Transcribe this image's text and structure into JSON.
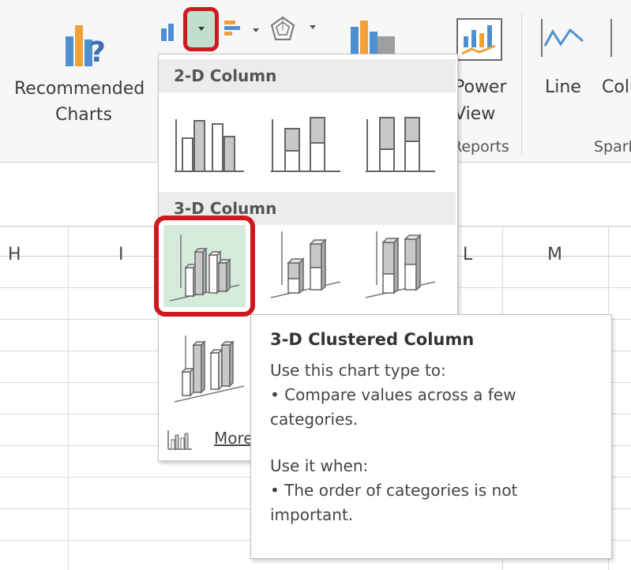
{
  "ribbon": {
    "recommended_line1": "Recommended",
    "recommended_line2": "Charts",
    "power_line1": "Power",
    "power_line2": "View",
    "reports_group": "Reports",
    "line_label": "Line",
    "column_label": "Column",
    "sparklines_group": "Sparklines"
  },
  "columns": [
    "H",
    "I",
    "L",
    "M"
  ],
  "dropdown": {
    "section_2d": "2-D Column",
    "section_3d": "3-D Column",
    "more_label": "More Column Charts..."
  },
  "tooltip": {
    "title": "3-D Clustered Column",
    "use_type_heading": "Use this chart type to:",
    "use_type_body": "• Compare values across a few categories.",
    "use_when_heading": "Use it when:",
    "use_when_body": "• The order of categories is not important."
  },
  "colors": {
    "highlight_red": "#d0181f",
    "selected_green": "#d5ebdc",
    "bar_gray": "#c8c8c8",
    "icon_blue": "#4e90cf",
    "icon_orange": "#f0a13a"
  }
}
